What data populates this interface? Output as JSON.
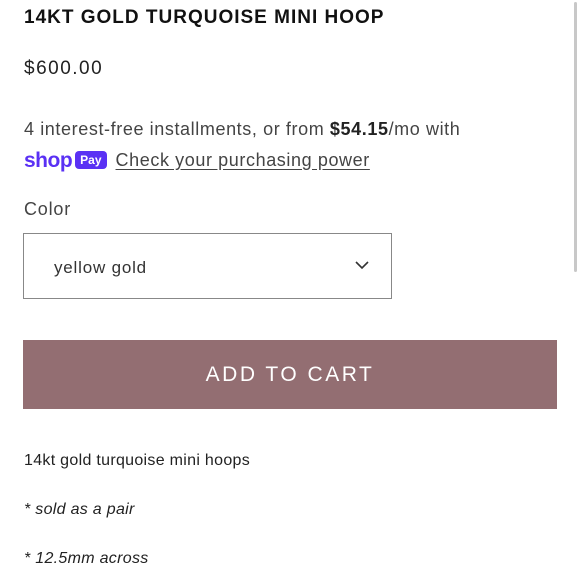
{
  "product": {
    "title": "14KT GOLD TURQUOISE MINI HOOP",
    "price": "$600.00"
  },
  "installments": {
    "prefix": "4 interest-free installments, or from ",
    "amount": "$54.15",
    "suffix": "/mo with",
    "shop_word": "shop",
    "pay_badge": "Pay",
    "link_text": "Check your purchasing power"
  },
  "color_selector": {
    "label": "Color",
    "selected": "yellow gold"
  },
  "cart": {
    "button_label": "ADD TO CART",
    "button_color": "#936e72"
  },
  "description": {
    "line1": "14kt gold turquoise mini hoops",
    "line2": "* sold as a pair",
    "line3": "* 12.5mm across"
  },
  "colors": {
    "shop_pay_brand": "#5a31f4"
  }
}
